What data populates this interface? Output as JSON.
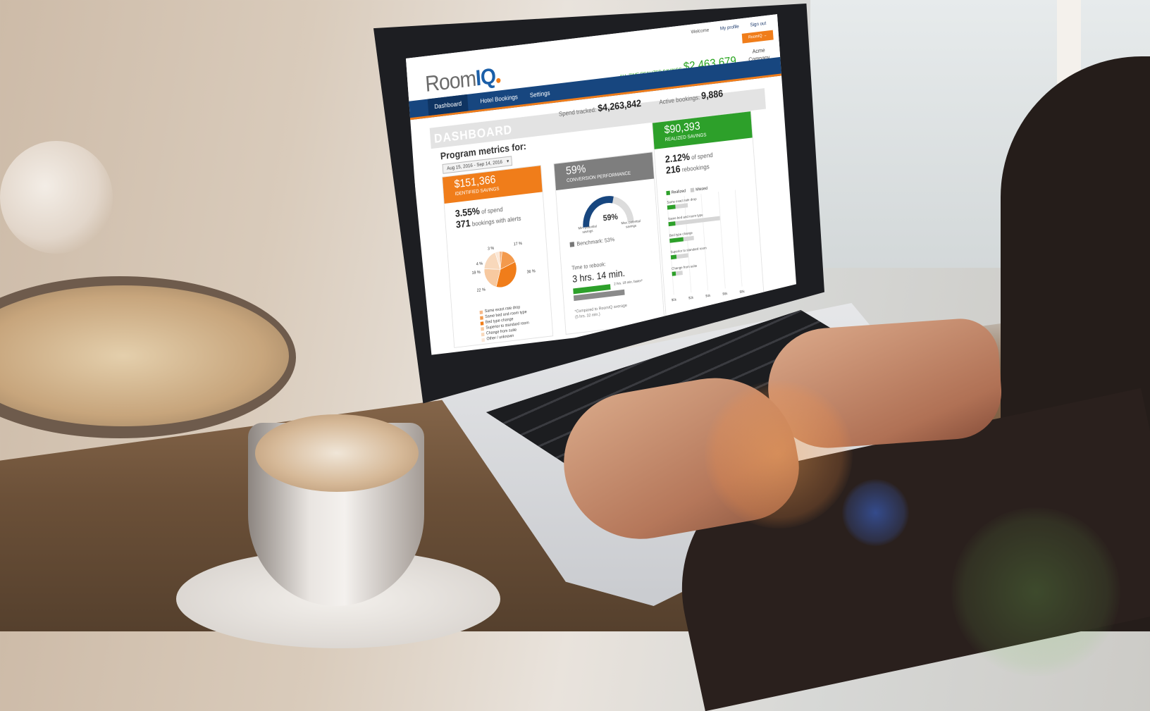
{
  "app": {
    "header": {
      "welcome": "Welcome",
      "my_profile": "My profile",
      "sign_out": "Sign out",
      "roomiq_button": "RoomIQ →",
      "logo_text": "Room",
      "logo_accent": "IQ",
      "company_line1": "Acme",
      "company_line2": "Company",
      "all_time_label": "ALL-TIME REALIZED SAVINGS",
      "all_time_value": "$2,463,679"
    },
    "nav": {
      "items": [
        {
          "label": "Dashboard",
          "active": true
        },
        {
          "label": "Hotel Bookings",
          "active": false
        },
        {
          "label": "Settings",
          "active": false
        }
      ]
    },
    "dashboard": {
      "title": "DASHBOARD",
      "spend_label": "Spend tracked:",
      "spend_value": "$4,263,842",
      "active_label": "Active bookings:",
      "active_value": "9,886",
      "program_metrics_label": "Program metrics for:",
      "date_range": "Aug 15, 2016 - Sep 14, 2016"
    },
    "identified": {
      "amount": "$151,366",
      "label": "IDENTIFIED SAVINGS",
      "pct": "3.55%",
      "pct_suffix": "of spend",
      "count": "371",
      "count_suffix": "bookings with alerts",
      "pie_labels": [
        "3 %",
        "17 %",
        "4 %",
        "19 %",
        "36 %",
        "22 %"
      ],
      "pie_values": [
        3,
        17,
        36,
        22,
        19,
        4
      ],
      "pie_colors": [
        "#f5b98a",
        "#f39a4d",
        "#f07d1a",
        "#f7c9a0",
        "#f8d8bb",
        "#fbe7d6"
      ],
      "legend": [
        "Same exact rate drop",
        "Same bed and room type",
        "Bed type change",
        "Superior to standard room",
        "Change from suite",
        "Other / unknown"
      ]
    },
    "conversion": {
      "pct": "59%",
      "label": "CONVERSION PERFORMANCE",
      "gauge_value": 59,
      "gauge_center": "59%",
      "gauge_left_label": "Min. potential savings",
      "gauge_right_label": "Max. potential savings",
      "benchmark_label": "Benchmark: 53%",
      "ttr_label": "Time to rebook:",
      "ttr_value": "3 hrs. 14 min.",
      "ttr_avg_label": "2 hrs. 18 min. faster*",
      "ttr_note_line1": "*Compared to RoomIQ average",
      "ttr_note_line2": "(5 hrs. 32 min.)"
    },
    "realized": {
      "amount": "$90,393",
      "label": "REALIZED SAVINGS",
      "pct": "2.12%",
      "pct_suffix": "of spend",
      "count": "216",
      "count_suffix": "rebookings",
      "legend_realized": "Realized",
      "legend_missed": "Missed",
      "rows": [
        {
          "label": "Same exact rate drop",
          "realized": 0.12,
          "missed": 0.3
        },
        {
          "label": "Same bed and room type",
          "realized": 0.1,
          "missed": 0.75
        },
        {
          "label": "Bed type change",
          "realized": 0.2,
          "missed": 0.35
        },
        {
          "label": "Superior to standard room",
          "realized": 0.08,
          "missed": 0.25
        },
        {
          "label": "Change from suite",
          "realized": 0.05,
          "missed": 0.15
        }
      ],
      "axis_ticks": [
        "$0k",
        "$2k",
        "$4k",
        "$6k",
        "$8k"
      ]
    },
    "colors": {
      "nav_blue": "#17467f",
      "accent_orange": "#f07d1a",
      "accent_green": "#2da02a",
      "gray": "#7e7e7e"
    }
  }
}
